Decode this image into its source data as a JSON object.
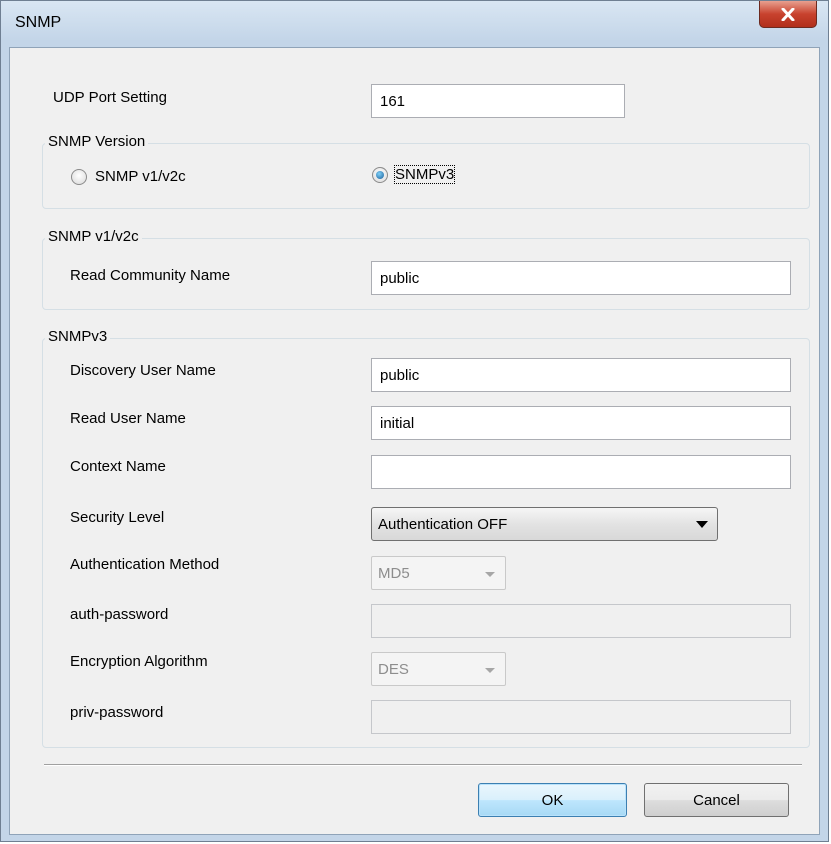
{
  "window": {
    "title": "SNMP"
  },
  "udp": {
    "label": "UDP Port Setting",
    "value": "161"
  },
  "version": {
    "legend": "SNMP Version",
    "option_v1": "SNMP v1/v2c",
    "option_v3": "SNMPv3",
    "selected": "SNMPv3"
  },
  "v1": {
    "legend": "SNMP v1/v2c",
    "read_community_label": "Read Community Name",
    "read_community_value": "public"
  },
  "v3": {
    "legend": "SNMPv3",
    "discovery_user_label": "Discovery User Name",
    "discovery_user_value": "public",
    "read_user_label": "Read User Name",
    "read_user_value": "initial",
    "context_label": "Context Name",
    "context_value": "",
    "security_level_label": "Security Level",
    "security_level_value": "Authentication OFF",
    "auth_method_label": "Authentication Method",
    "auth_method_value": "MD5",
    "auth_password_label": "auth-password",
    "auth_password_value": "",
    "encryption_label": "Encryption Algorithm",
    "encryption_value": "DES",
    "priv_password_label": "priv-password",
    "priv_password_value": ""
  },
  "buttons": {
    "ok": "OK",
    "cancel": "Cancel"
  },
  "colors": {
    "titlebar": "#c3d5e8",
    "close": "#c8422e",
    "client": "#f0f0f0",
    "default_button": "#bee6fd"
  }
}
